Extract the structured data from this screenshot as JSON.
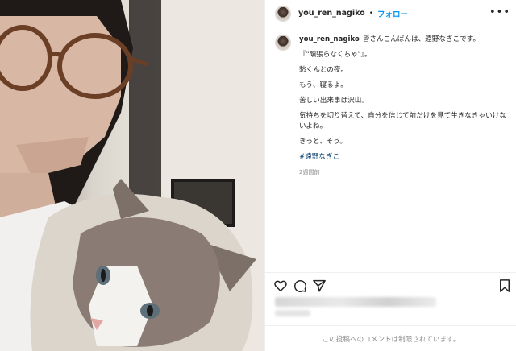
{
  "post": {
    "username": "you_ren_nagiko",
    "separator": "•",
    "follow_label": "フォロー",
    "more_icon": "more-horizontal-icon"
  },
  "caption": {
    "username": "you_ren_nagiko",
    "lines": [
      "皆さんこんばんは、遠野なぎこです。",
      "『\"頑張らなくちゃ\"』。",
      "愁くんとの夜。",
      "もう、寝るよ。",
      "苦しい出来事は沢山。",
      "気持ちを切り替えて、自分を信じて前だけを見て生きなきゃいけないよね。",
      "きっと、そう。"
    ],
    "hashtag": "#遠野なぎこ",
    "time": "2週間前"
  },
  "actions": {
    "like_icon": "heart-icon",
    "comment_icon": "comment-icon",
    "share_icon": "send-icon",
    "save_icon": "bookmark-icon"
  },
  "footer": {
    "comments_limited_text": "この投稿へのコメントは制限されています。"
  },
  "colors": {
    "link_blue": "#0095f6",
    "hashtag": "#00376b",
    "muted": "#8e8e8e",
    "border": "#efefef"
  }
}
